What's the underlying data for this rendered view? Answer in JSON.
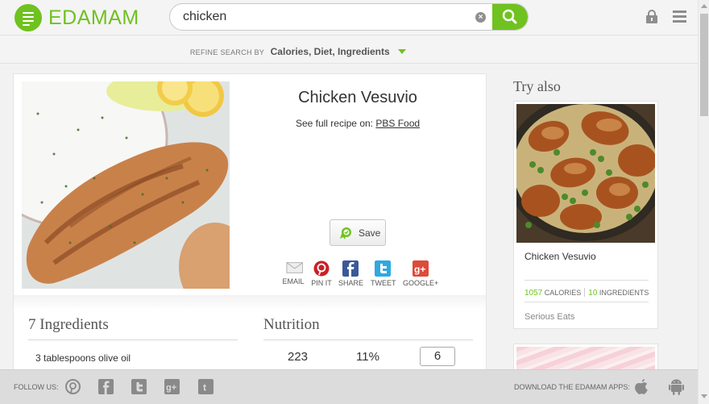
{
  "header": {
    "logo_text": "EDAMAM",
    "search_value": "chicken",
    "brand_color": "#6fc21f"
  },
  "refine": {
    "label": "REFINE SEARCH BY",
    "value": "Calories, Diet, Ingredients"
  },
  "recipe": {
    "title": "Chicken Vesuvio",
    "source_prefix": "See full recipe on:",
    "source_name": "PBS Food",
    "save_label": "Save",
    "share": [
      {
        "label": "EMAIL",
        "icon": "email-icon",
        "color": "#e8e8e8"
      },
      {
        "label": "PIN IT",
        "icon": "pinterest-icon",
        "color": "#cb2027"
      },
      {
        "label": "SHARE",
        "icon": "facebook-icon",
        "color": "#3b5998"
      },
      {
        "label": "TWEET",
        "icon": "twitter-icon",
        "color": "#2fa9e0"
      },
      {
        "label": "GOOGLE+",
        "icon": "google-plus-icon",
        "color": "#dd4b39"
      }
    ]
  },
  "ingredients": {
    "heading": "7 Ingredients",
    "items": [
      "3 tablespoons olive oil"
    ]
  },
  "nutrition": {
    "heading": "Nutrition",
    "calories": "223",
    "percent": "11%",
    "servings": "6"
  },
  "sidebar": {
    "heading": "Try also",
    "card": {
      "title": "Chicken Vesuvio",
      "calories": "1057",
      "calories_label": "CALORIES",
      "ingredients": "10",
      "ingredients_label": "INGREDIENTS",
      "source": "Serious Eats"
    }
  },
  "footer": {
    "follow_label": "FOLLOW US:",
    "download_label": "DOWNLOAD THE EDAMAM APPS:"
  }
}
